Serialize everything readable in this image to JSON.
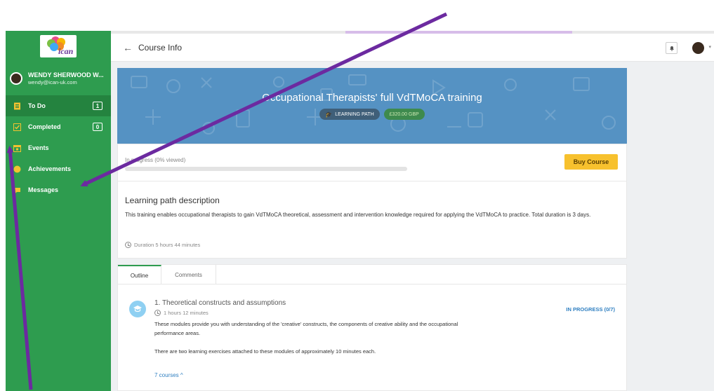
{
  "brand": {
    "logo_text": "ican"
  },
  "user": {
    "name": "WENDY SHERWOOD W...",
    "email": "wendy@ican-uk.com"
  },
  "nav": [
    {
      "label": "To Do",
      "icon": "todo-list-icon",
      "count": "1",
      "active": true
    },
    {
      "label": "Completed",
      "icon": "check-square-icon",
      "count": "0",
      "active": false
    },
    {
      "label": "Events",
      "icon": "calendar-icon",
      "count": "",
      "active": false
    },
    {
      "label": "Achievements",
      "icon": "trophy-icon",
      "count": "",
      "active": false
    },
    {
      "label": "Messages",
      "icon": "chat-bubble-icon",
      "count": "",
      "active": false
    }
  ],
  "header": {
    "back_glyph": "←",
    "title": "Course Info"
  },
  "course": {
    "title": "Occupational Therapists' full VdTMoCA training",
    "tag_type": "LEARNING PATH",
    "tag_price": "£320.00 GBP",
    "progress_label": "In progress (0% viewed)",
    "progress_fraction": 0,
    "buy_label": "Buy Course",
    "desc_title": "Learning path description",
    "desc_text": "This training enables occupational therapists to gain VdTMoCA theoretical, assessment and intervention knowledge required for applying the VdTMoCA to practice. Total duration is 3 days.",
    "duration": "Duration 5 hours 44 minutes"
  },
  "tabs": {
    "outline": "Outline",
    "comments": "Comments"
  },
  "module": {
    "title": "1. Theoretical constructs and assumptions",
    "time": "1 hours 12 minutes",
    "status": "IN PROGRESS (0/7)",
    "para1": "These modules provide you with understanding of the 'creative' constructs, the components of creative ability and the occupational performance areas.",
    "para2": "There are two learning exercises attached to these modules of approximately 10 minutes each.",
    "courses_link": "7 courses ^"
  },
  "colors": {
    "sidebar": "#2e9c4f",
    "banner": "#5592c3",
    "accent_yellow": "#f7c12e",
    "link_blue": "#2f7fc1",
    "arrow_purple": "#6c2aa0"
  }
}
